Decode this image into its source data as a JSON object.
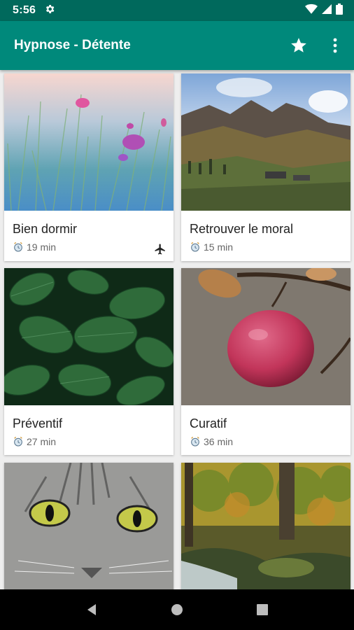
{
  "status_bar": {
    "time": "5:56"
  },
  "app_bar": {
    "title": "Hypnose - Détente",
    "favorite_icon": "star-icon",
    "menu_icon": "more-vert-icon"
  },
  "cards": [
    {
      "title": "Bien dormir",
      "duration": "19 min",
      "airplane_mode": true
    },
    {
      "title": "Retrouver le moral",
      "duration": "15 min"
    },
    {
      "title": "Préventif",
      "duration": "27 min"
    },
    {
      "title": "Curatif",
      "duration": "36 min"
    },
    {
      "title": "",
      "duration": ""
    },
    {
      "title": "",
      "duration": ""
    }
  ],
  "colors": {
    "status_bar": "#00695c",
    "app_bar": "#00897b",
    "nav_bar": "#000000"
  }
}
